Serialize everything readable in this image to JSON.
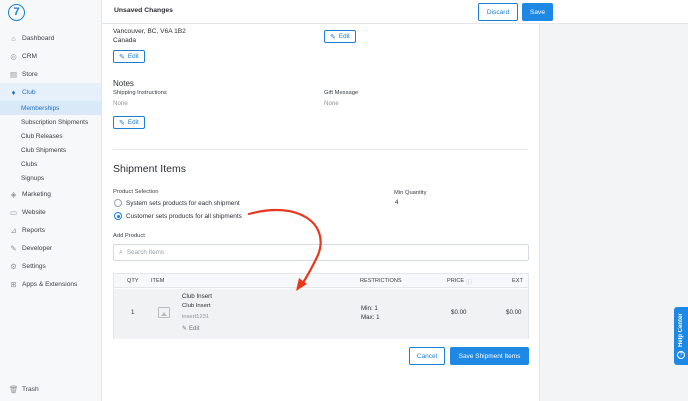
{
  "topbar": {
    "title": "Unsaved Changes",
    "discard_label": "Discard",
    "save_label": "Save"
  },
  "sidebar": {
    "logo": "7",
    "items": [
      {
        "label": "Dashboard",
        "icon": "home-icon",
        "glyph": "⌂"
      },
      {
        "label": "CRM",
        "icon": "crm-icon",
        "glyph": "◎"
      },
      {
        "label": "Store",
        "icon": "store-icon",
        "glyph": "▤"
      },
      {
        "label": "Club",
        "icon": "club-icon",
        "glyph": "♦"
      },
      {
        "label": "Marketing",
        "icon": "marketing-icon",
        "glyph": "◈"
      },
      {
        "label": "Website",
        "icon": "website-icon",
        "glyph": "▭"
      },
      {
        "label": "Reports",
        "icon": "reports-icon",
        "glyph": "⊿"
      },
      {
        "label": "Developer",
        "icon": "developer-icon",
        "glyph": "✎"
      },
      {
        "label": "Settings",
        "icon": "gear-icon",
        "glyph": "⚙"
      },
      {
        "label": "Apps & Extensions",
        "icon": "apps-icon",
        "glyph": "⊞"
      }
    ],
    "club_sub": [
      "Memberships",
      "Subscription Shipments",
      "Club Releases",
      "Club Shipments",
      "Clubs",
      "Signups"
    ],
    "trash": "Trash"
  },
  "address": {
    "line1": "Vancouver, BC, V6A 1B2",
    "line2": "Canada",
    "edit_label": "Edit"
  },
  "notes": {
    "heading": "Notes",
    "shipping_label": "Shipping Instructions",
    "shipping_value": "None",
    "gift_label": "Gift Message",
    "gift_value": "None",
    "edit_label": "Edit"
  },
  "shipment": {
    "heading": "Shipment Items",
    "product_selection_label": "Product Selection",
    "option_system": "System sets products for each shipment",
    "option_customer": "Customer sets products for all shipments",
    "selected": "customer",
    "min_qty_label": "Min Quantity",
    "min_qty_value": "4",
    "add_product_label": "Add Product",
    "search_placeholder": "Search Items",
    "columns": {
      "qty": "QTY",
      "item": "ITEM",
      "restrictions": "RESTRICTIONS",
      "price": "PRICE",
      "ext": "EXT"
    },
    "row": {
      "qty": "1",
      "name": "Club Insert",
      "subname": "Club Insert",
      "sku": "insert1231",
      "edit": "Edit",
      "min": "Min: 1",
      "max": "Max: 1",
      "price": "$0.00",
      "ext": "$0.00"
    },
    "cancel_label": "Cancel",
    "save_label": "Save Shipment Items"
  },
  "help": {
    "label": "Help Center"
  },
  "colors": {
    "accent": "#1e88e5",
    "annotation": "#e8391f"
  }
}
